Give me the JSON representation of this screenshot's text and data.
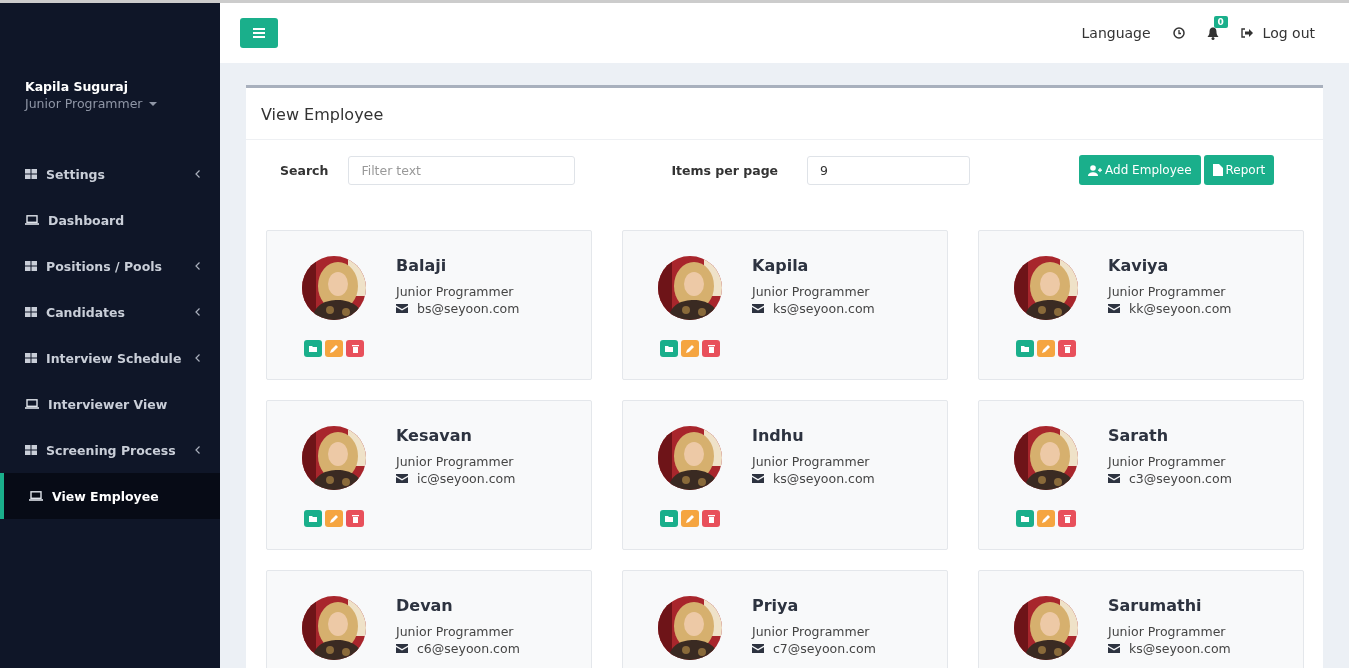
{
  "sidebar": {
    "user": {
      "name": "Kapila Suguraj",
      "role": "Junior Programmer"
    },
    "items": [
      {
        "label": "Settings",
        "kind": "group",
        "expandable": true,
        "selected": false
      },
      {
        "label": "Dashboard",
        "kind": "page",
        "expandable": false,
        "selected": false
      },
      {
        "label": "Positions / Pools",
        "kind": "group",
        "expandable": true,
        "selected": false
      },
      {
        "label": "Candidates",
        "kind": "group",
        "expandable": true,
        "selected": false
      },
      {
        "label": "Interview Schedule",
        "kind": "group",
        "expandable": true,
        "selected": false
      },
      {
        "label": "Interviewer View",
        "kind": "page",
        "expandable": false,
        "selected": false
      },
      {
        "label": "Screening Process",
        "kind": "group",
        "expandable": true,
        "selected": false
      },
      {
        "label": "View Employee",
        "kind": "page",
        "expandable": false,
        "selected": true
      }
    ]
  },
  "topbar": {
    "language": "Language",
    "notification_count": "0",
    "logout": "Log out"
  },
  "panel": {
    "title": "View Employee",
    "search_label": "Search",
    "search": {
      "placeholder": "Filter text"
    },
    "items_label": "Items per page",
    "items_per_page": "9",
    "buttons": [
      {
        "label": "Add Employee"
      },
      {
        "label": "Report"
      }
    ]
  },
  "employees": [
    {
      "name": "Balaji",
      "role": "Junior Programmer",
      "email": "bs@seyoon.com"
    },
    {
      "name": "Kapila",
      "role": "Junior Programmer",
      "email": "ks@seyoon.com"
    },
    {
      "name": "Kaviya",
      "role": "Junior Programmer",
      "email": "kk@seyoon.com"
    },
    {
      "name": "Kesavan",
      "role": "Junior Programmer",
      "email": "ic@seyoon.com"
    },
    {
      "name": "Indhu",
      "role": "Junior Programmer",
      "email": "ks@seyoon.com"
    },
    {
      "name": "Sarath",
      "role": "Junior Programmer",
      "email": "c3@seyoon.com"
    },
    {
      "name": "Devan",
      "role": "Junior Programmer",
      "email": "c6@seyoon.com"
    },
    {
      "name": "Priya",
      "role": "Junior Programmer",
      "email": "c7@seyoon.com"
    },
    {
      "name": "Sarumathi",
      "role": "Junior Programmer",
      "email": "ks@seyoon.com"
    }
  ]
}
